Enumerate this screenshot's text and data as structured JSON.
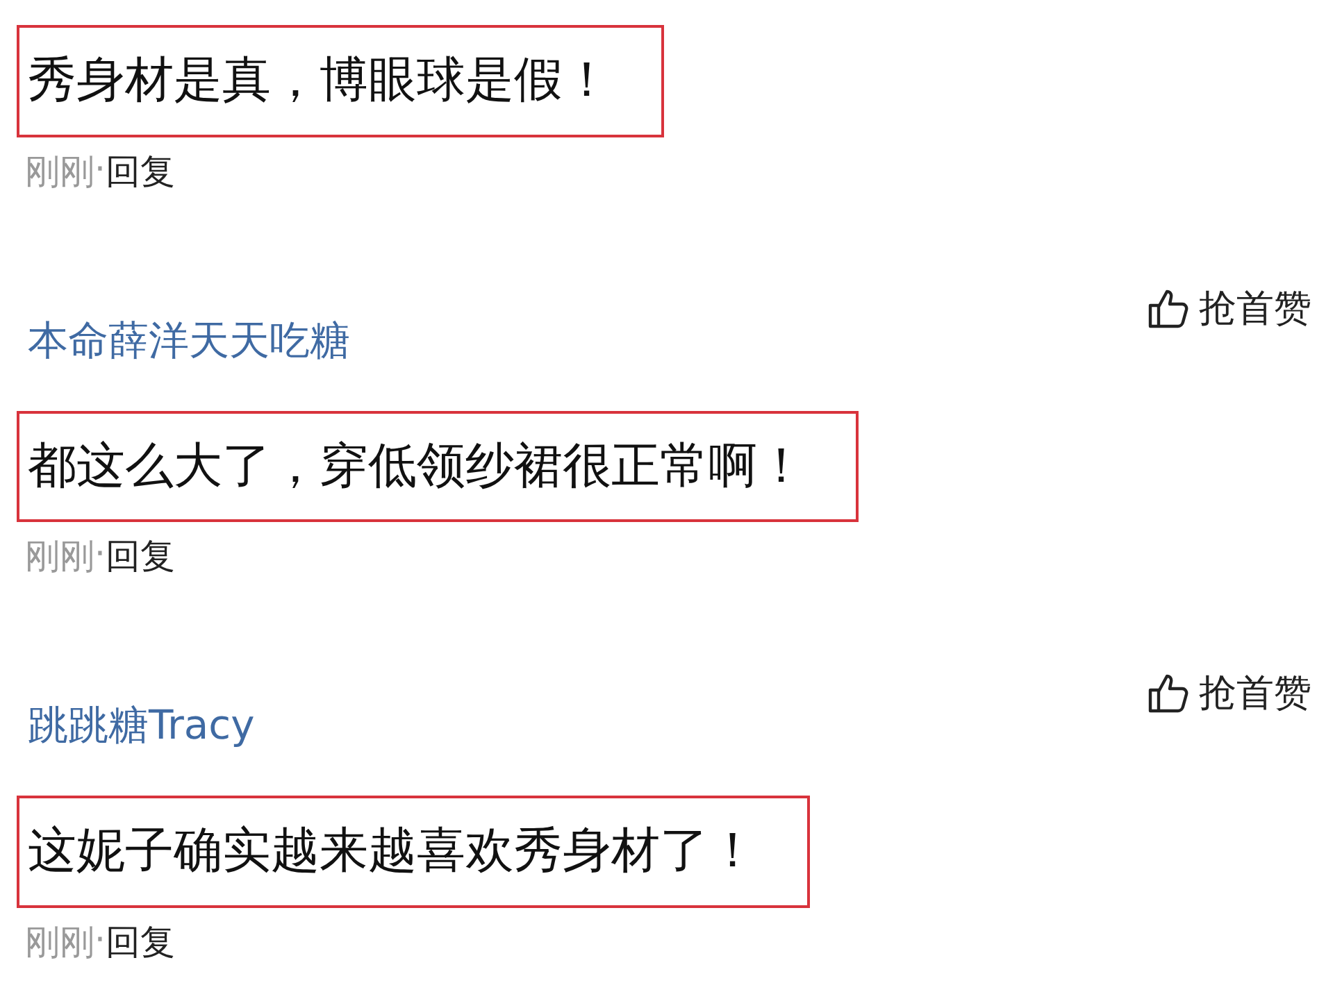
{
  "comments": [
    {
      "text": "秀身材是真，博眼球是假！",
      "highlighted": true,
      "time": "刚刚",
      "separator": "·",
      "reply": "回复"
    },
    {
      "user": "本命薛洋天天吃糖",
      "like": "抢首赞",
      "text": "都这么大了，穿低领纱裙很正常啊！",
      "highlighted": true,
      "time": "刚刚",
      "separator": "·",
      "reply": "回复"
    },
    {
      "user": "跳跳糖Tracy",
      "like": "抢首赞",
      "text": "这妮子确实越来越喜欢秀身材了！",
      "highlighted": true,
      "time": "刚刚",
      "separator": "·",
      "reply": "回复"
    }
  ]
}
